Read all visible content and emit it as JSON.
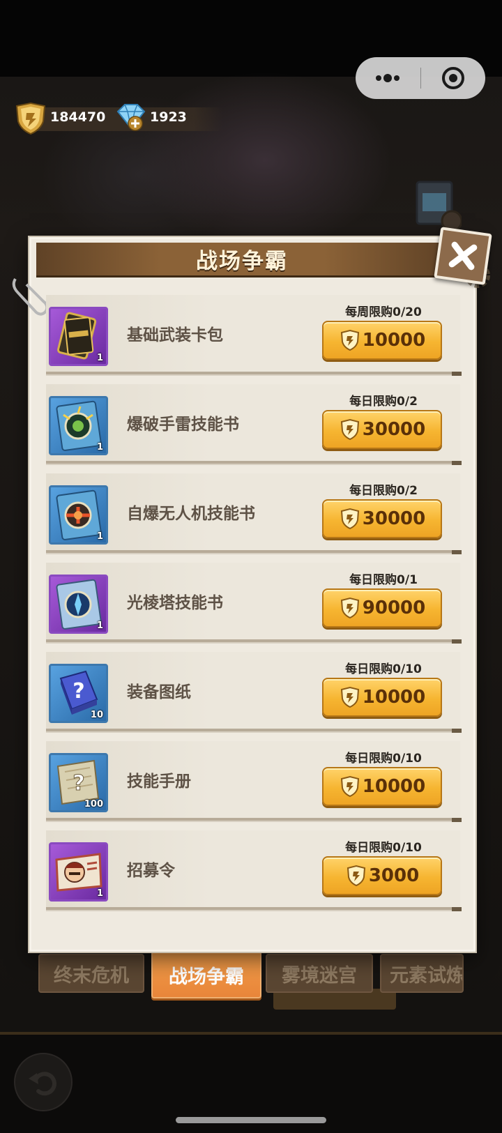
{
  "currency": {
    "medals": "184470",
    "diamonds": "1923"
  },
  "panel": {
    "title": "战场争霸"
  },
  "items": [
    {
      "name": "基础武装卡包",
      "limit": "每周限购0/20",
      "price": "10000",
      "qty": "1",
      "rarity": "purple",
      "icon": "card-pack-icon"
    },
    {
      "name": "爆破手雷技能书",
      "limit": "每日限购0/2",
      "price": "30000",
      "qty": "1",
      "rarity": "blue",
      "icon": "grenade-skillbook-icon"
    },
    {
      "name": "自爆无人机技能书",
      "limit": "每日限购0/2",
      "price": "30000",
      "qty": "1",
      "rarity": "blue",
      "icon": "drone-skillbook-icon"
    },
    {
      "name": "光棱塔技能书",
      "limit": "每日限购0/1",
      "price": "90000",
      "qty": "1",
      "rarity": "purple",
      "icon": "prism-tower-skillbook-icon"
    },
    {
      "name": "装备图纸",
      "limit": "每日限购0/10",
      "price": "10000",
      "qty": "10",
      "rarity": "blue",
      "icon": "equipment-blueprint-icon"
    },
    {
      "name": "技能手册",
      "limit": "每日限购0/10",
      "price": "10000",
      "qty": "100",
      "rarity": "blue",
      "icon": "skill-manual-icon"
    },
    {
      "name": "招募令",
      "limit": "每日限购0/10",
      "price": "3000",
      "qty": "1",
      "rarity": "purple",
      "icon": "recruit-order-icon"
    }
  ],
  "tabs": [
    {
      "label": "终末危机",
      "active": false
    },
    {
      "label": "战场争霸",
      "active": true
    },
    {
      "label": "雾境迷宫",
      "active": false
    },
    {
      "label": "元素试炼",
      "active": false
    }
  ],
  "colors": {
    "accent": "#f6b531",
    "tab_active": "#f09445",
    "panel_header": "#8b6237"
  }
}
